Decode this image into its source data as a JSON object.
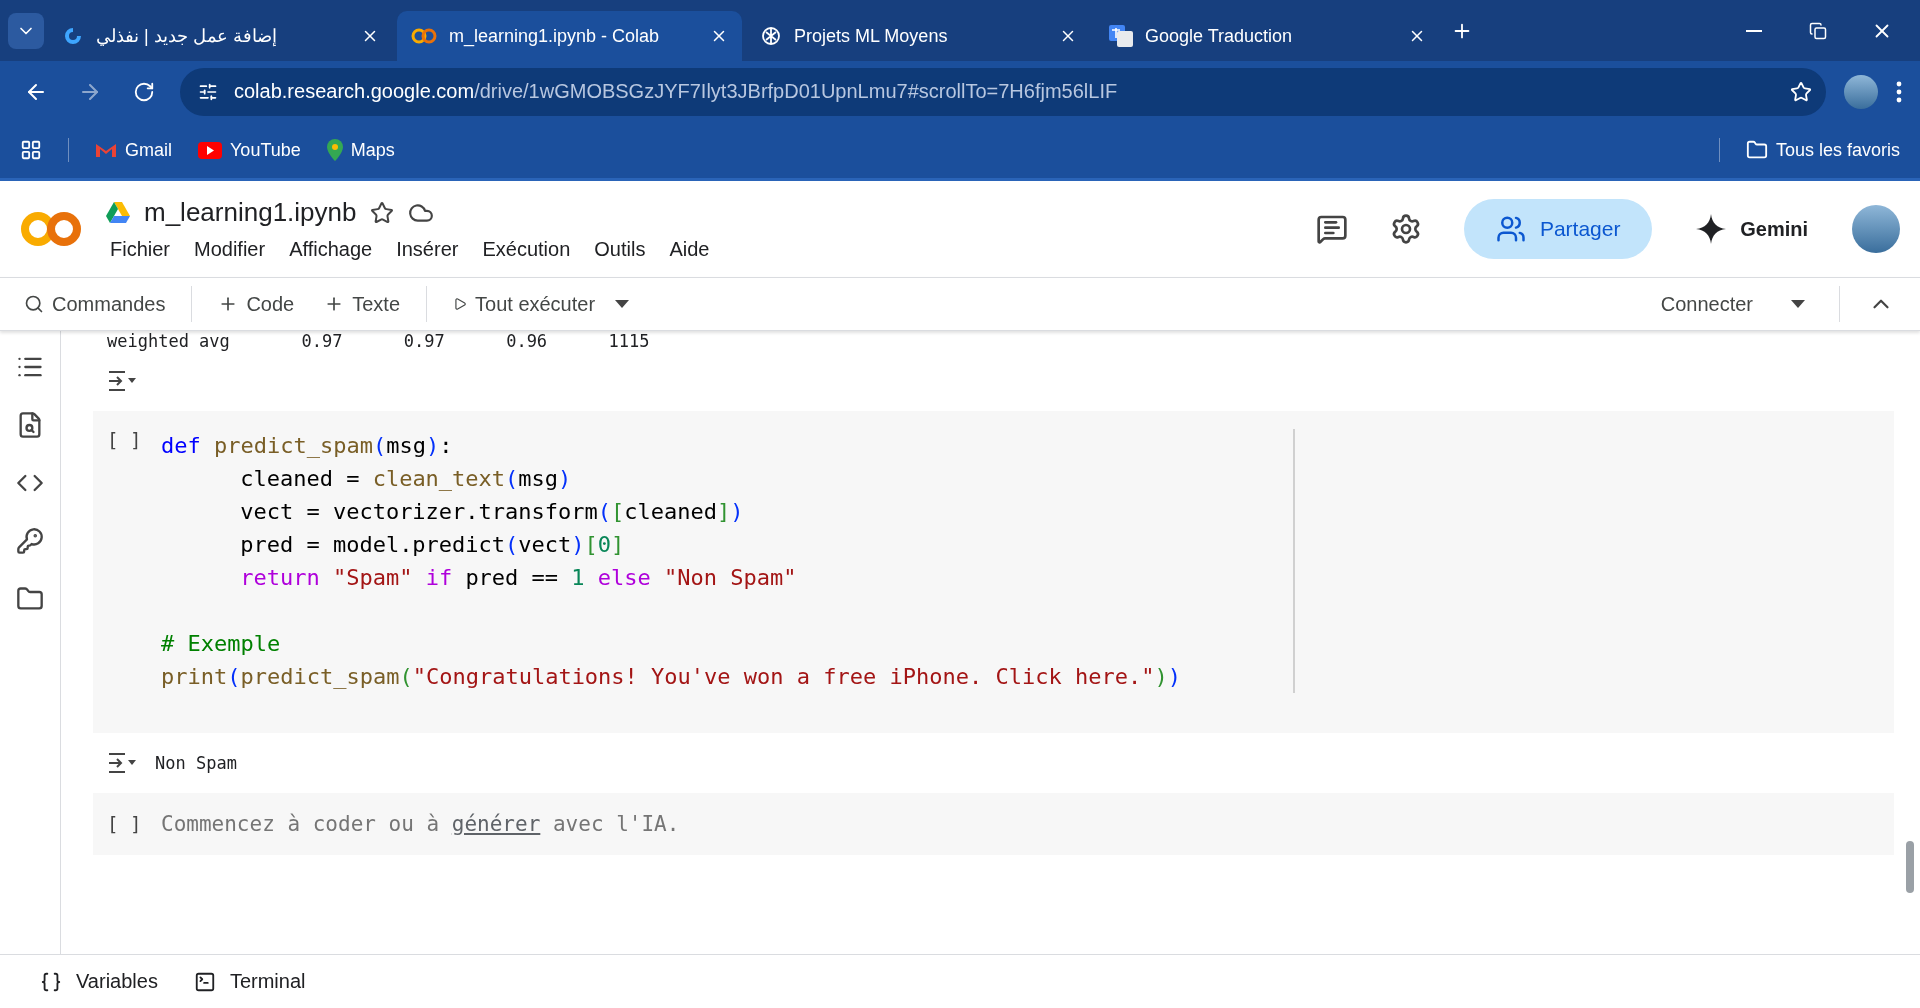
{
  "browser": {
    "tabs": [
      {
        "title": "إضافة عمل جديد | نفذلي",
        "kind": "swirl",
        "selected": false
      },
      {
        "title": "m_learning1.ipynb - Colab",
        "kind": "colab",
        "selected": true
      },
      {
        "title": "Projets ML Moyens",
        "kind": "knot",
        "selected": false
      },
      {
        "title": "Google Traduction",
        "kind": "translate",
        "selected": false
      }
    ],
    "address": {
      "host": "colab.research.google.com",
      "path": "/drive/1wGMOBSGzJYF7Ilyt3JBrfpD01UpnLmu7#scrollTo=7H6fjm56lLIF"
    },
    "bookmarks": [
      {
        "label": "Gmail",
        "kind": "gmail"
      },
      {
        "label": "YouTube",
        "kind": "youtube"
      },
      {
        "label": "Maps",
        "kind": "maps"
      }
    ],
    "all_bookmarks": "Tous les favoris"
  },
  "colab": {
    "notebook_title": "m_learning1.ipynb",
    "menu": [
      "Fichier",
      "Modifier",
      "Affichage",
      "Insérer",
      "Exécution",
      "Outils",
      "Aide"
    ],
    "share": "Partager",
    "gemini": "Gemini",
    "toolbar": {
      "commands": "Commandes",
      "add_code": "Code",
      "add_text": "Texte",
      "run_all": "Tout exécuter",
      "connect": "Connecter"
    }
  },
  "cells": [
    {
      "kind": "output_text",
      "text": "weighted avg       0.97      0.97      0.96      1115"
    },
    {
      "kind": "output"
    },
    {
      "kind": "code",
      "run_marker": "[ ]",
      "lines": [
        {
          "indent": false,
          "gap_before": false,
          "tokens": [
            {
              "kind": "kw",
              "text": "def "
            },
            {
              "kind": "fn",
              "text": "predict_spam"
            },
            {
              "kind": "br",
              "text": "("
            },
            {
              "kind": "p",
              "text": "msg"
            },
            {
              "kind": "br",
              "text": ")"
            },
            {
              "kind": "p",
              "text": ":"
            }
          ]
        },
        {
          "indent": true,
          "gap_before": false,
          "tokens": [
            {
              "kind": "p",
              "text": "cleaned = "
            },
            {
              "kind": "fn",
              "text": "clean_text"
            },
            {
              "kind": "br",
              "text": "("
            },
            {
              "kind": "p",
              "text": "msg"
            },
            {
              "kind": "br",
              "text": ")"
            }
          ]
        },
        {
          "indent": true,
          "gap_before": false,
          "tokens": [
            {
              "kind": "p",
              "text": "vect = vectorizer.transform"
            },
            {
              "kind": "br",
              "text": "("
            },
            {
              "kind": "sq",
              "text": "["
            },
            {
              "kind": "p",
              "text": "cleaned"
            },
            {
              "kind": "sq",
              "text": "]"
            },
            {
              "kind": "br",
              "text": ")"
            }
          ]
        },
        {
          "indent": true,
          "gap_before": false,
          "tokens": [
            {
              "kind": "p",
              "text": "pred = model.predict"
            },
            {
              "kind": "br",
              "text": "("
            },
            {
              "kind": "p",
              "text": "vect"
            },
            {
              "kind": "br",
              "text": ")"
            },
            {
              "kind": "sq",
              "text": "["
            },
            {
              "kind": "num",
              "text": "0"
            },
            {
              "kind": "sq",
              "text": "]"
            }
          ]
        },
        {
          "indent": true,
          "gap_before": false,
          "tokens": [
            {
              "kind": "ctl",
              "text": "return "
            },
            {
              "kind": "str",
              "text": "\"Spam\""
            },
            {
              "kind": "ctl",
              "text": " if "
            },
            {
              "kind": "p",
              "text": "pred == "
            },
            {
              "kind": "num",
              "text": "1"
            },
            {
              "kind": "ctl",
              "text": " else "
            },
            {
              "kind": "str",
              "text": "\"Non Spam\""
            }
          ]
        },
        {
          "indent": false,
          "gap_before": true,
          "tokens": [
            {
              "kind": "cm",
              "text": "# Exemple"
            }
          ]
        },
        {
          "indent": false,
          "gap_before": false,
          "tokens": [
            {
              "kind": "fn",
              "text": "print"
            },
            {
              "kind": "br",
              "text": "("
            },
            {
              "kind": "fn",
              "text": "predict_spam"
            },
            {
              "kind": "br2",
              "text": "("
            },
            {
              "kind": "str",
              "text": "\"Congratulations! You've won a free iPhone. Click here.\""
            },
            {
              "kind": "br2",
              "text": ")"
            },
            {
              "kind": "br",
              "text": ")"
            }
          ]
        }
      ]
    },
    {
      "kind": "output",
      "text": "Non Spam"
    },
    {
      "kind": "empty",
      "run_marker": "[ ]",
      "before": "Commencez à coder ou à ",
      "link": "générer",
      "after": " avec l'IA."
    }
  ],
  "bottom_bar": [
    "Variables",
    "Terminal"
  ]
}
